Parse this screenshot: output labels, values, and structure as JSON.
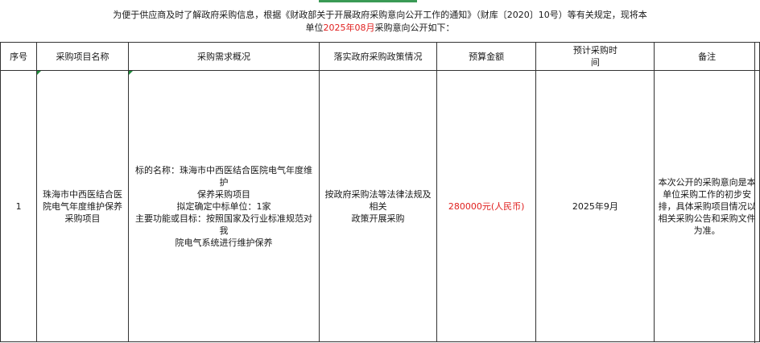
{
  "intro": {
    "line1": "为便于供应商及时了解政府采购信息，根据《财政部关于开展政府采购意向公开工作的通知》（财库〔2020〕10号）等有关规定，现将本",
    "line2_prefix": "单位",
    "line2_highlight": "2025年08月",
    "line2_suffix": "采购意向公开如下："
  },
  "table": {
    "headers": {
      "seq": "序号",
      "project_name": "采购项目名称",
      "demand": "采购需求概况",
      "policy": "落实政府采购政策情况",
      "budget": "预算金额",
      "time_l1": "预计采购时",
      "time_l2": "间",
      "remark": "备注"
    },
    "row": {
      "seq": "1",
      "project_name": "珠海市中西医结合医院电气年度维护保养采购项目",
      "demand_l1": "标的名称：珠海市中西医结合医院电气年度维护",
      "demand_l2": "保养采购项目",
      "demand_l3": "拟定确定中标单位：1家",
      "demand_l4": "主要功能或目标：按照国家及行业标准规范对我",
      "demand_l5": "院电气系统进行维护保养",
      "policy_l1": "按政府采购法等法律法规及",
      "policy_l2": "相关",
      "policy_l3": "政策开展采购",
      "budget": "280000元(人民币)",
      "time": "2025年9月",
      "remark": "本次公开的采购意向是本单位采购工作的初步安排，具体采购项目情况以相关采购公告和采购文件为准。"
    }
  },
  "colors": {
    "highlight": "#e0201f",
    "accent_green": "#3a9a55",
    "border": "#333333"
  }
}
